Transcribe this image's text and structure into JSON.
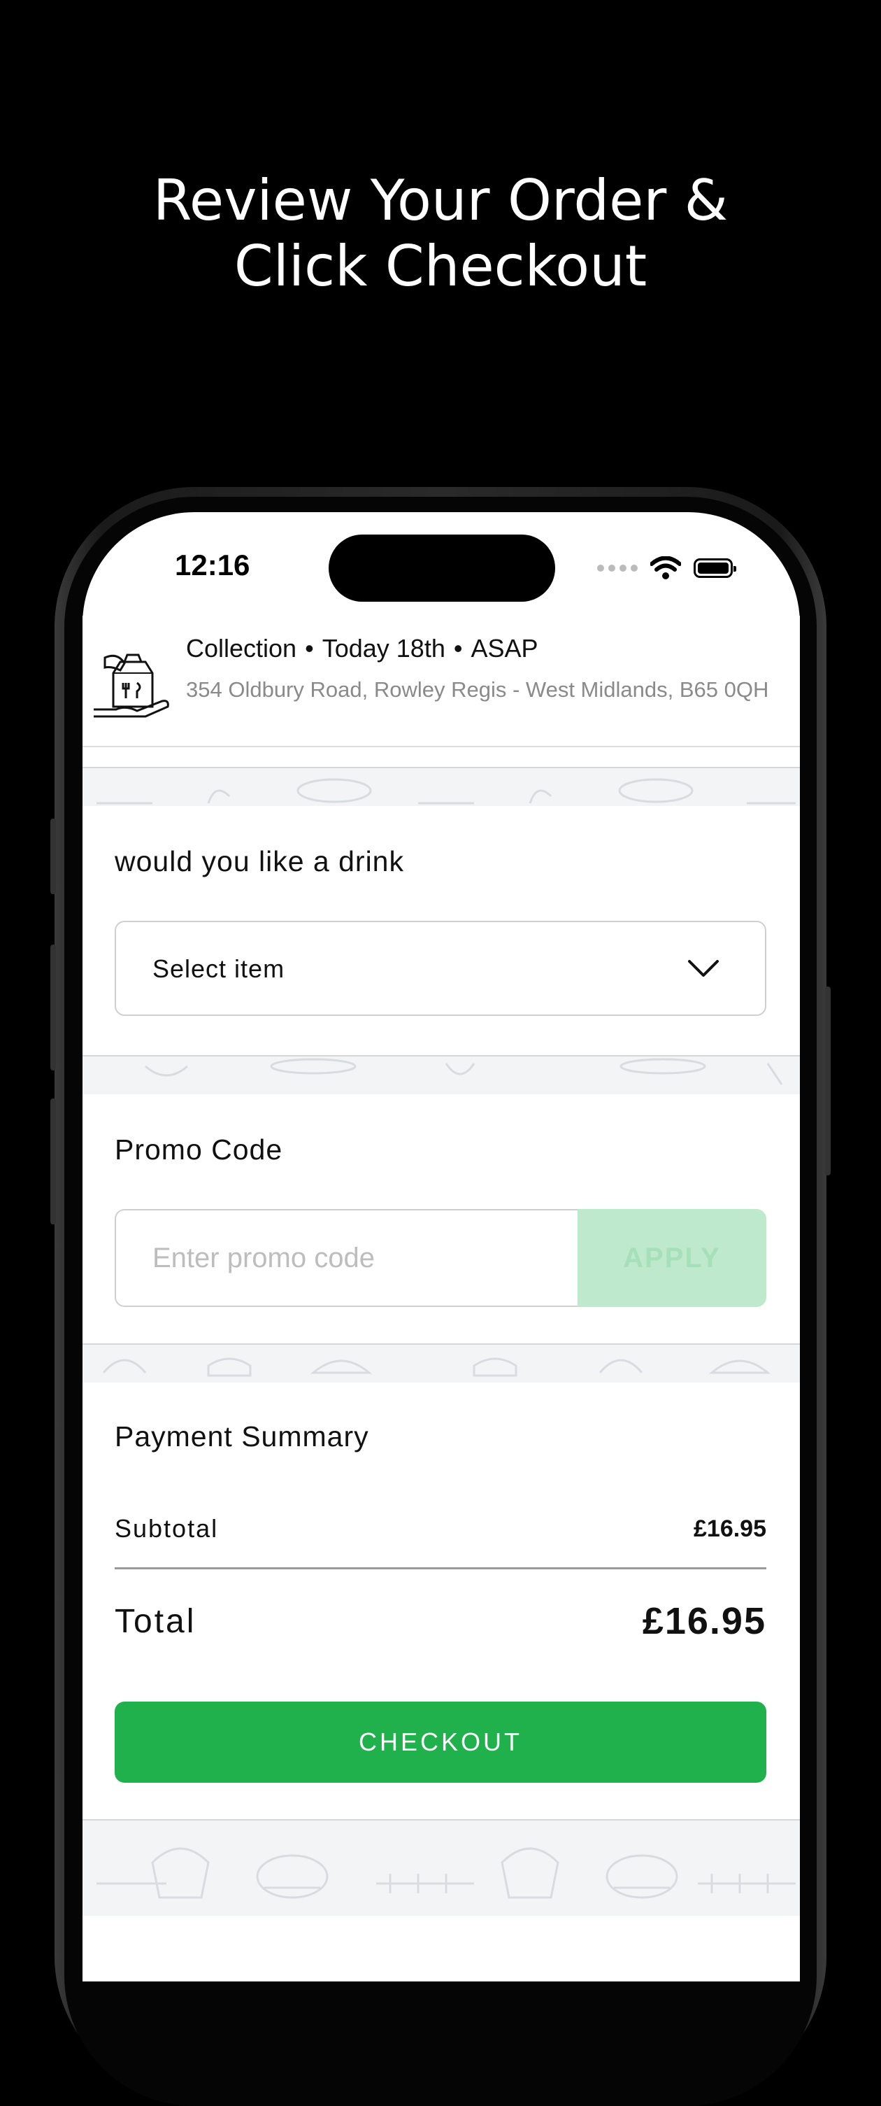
{
  "headline": {
    "line1": "Review Your Order &",
    "line2": "Click Checkout"
  },
  "status_bar": {
    "time": "12:16"
  },
  "order_header": {
    "mode": "Collection",
    "day": "Today 18th",
    "timing": "ASAP",
    "separator": "•",
    "address": "354 Oldbury Road, Rowley Regis - West Midlands, B65 0QH"
  },
  "drink_section": {
    "title": "would you like a drink",
    "select_value": "Select item"
  },
  "promo_section": {
    "title": "Promo Code",
    "placeholder": "Enter promo code",
    "apply_label": "APPLY"
  },
  "payment_summary": {
    "title": "Payment Summary",
    "subtotal_label": "Subtotal",
    "subtotal_value": "£16.95",
    "total_label": "Total",
    "total_value": "£16.95"
  },
  "checkout_label": "CHECKOUT",
  "colors": {
    "accent": "#20b14d",
    "apply_disabled": "#bfe9cc",
    "background": "#000000"
  }
}
